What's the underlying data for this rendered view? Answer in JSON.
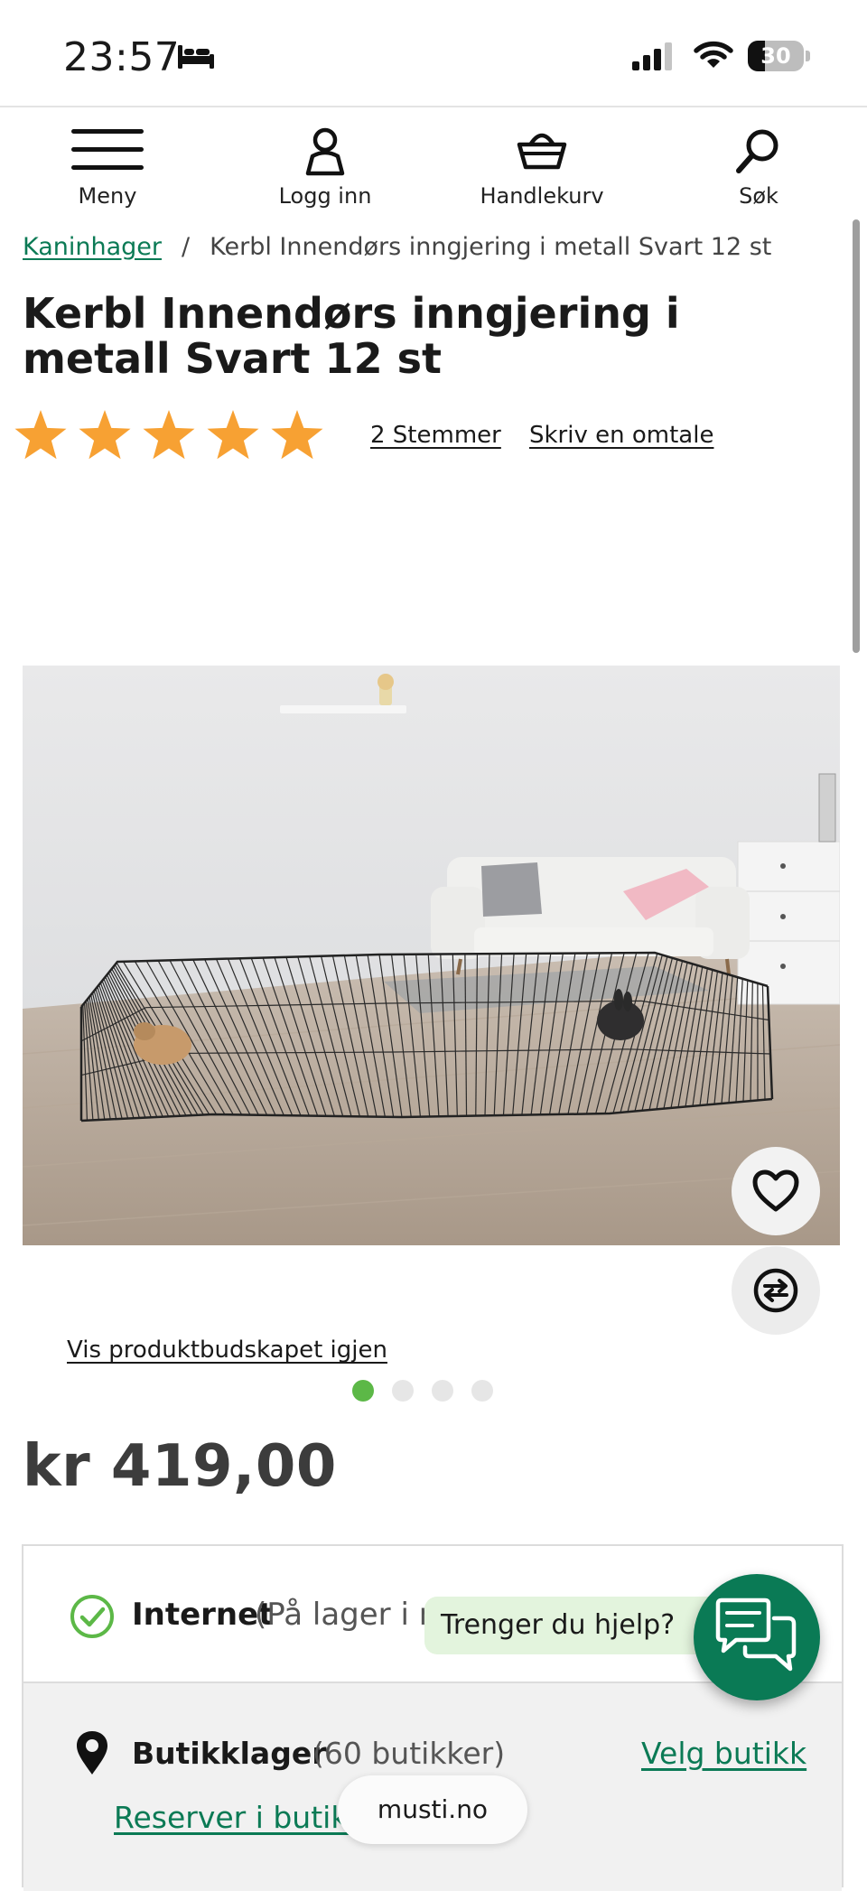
{
  "status_bar": {
    "time": "23:57",
    "battery_level": "30",
    "battery_fraction": 0.3,
    "signal_bars": 3,
    "signal_max": 4
  },
  "nav": {
    "menu_label": "Meny",
    "login_label": "Logg inn",
    "cart_label": "Handlekurv",
    "search_label": "Søk"
  },
  "breadcrumb": {
    "parent": "Kaninhager",
    "separator": "/",
    "current": "Kerbl Innendørs inngjering i metall Svart 12 st"
  },
  "product": {
    "title": "Kerbl Innendørs inngjering i metall Svart 12 st",
    "rating": 5,
    "rating_max": 5,
    "votes_label": "2 Stemmer",
    "review_label": "Skriv en omtale",
    "show_message_label": "Vis produktbudskapet igjen",
    "gallery": {
      "count": 4,
      "active_index": 0
    },
    "price": "kr 419,00"
  },
  "availability": {
    "internet_label": "Internet",
    "internet_status": "(På lager i ne",
    "store_label": "Butikklager",
    "store_count": "(60 butikker)",
    "choose_store_label": "Velg butikk",
    "reserve_label": "Reserver i butikk"
  },
  "help": {
    "bubble_text": "Trenger du hjelp?"
  },
  "browser": {
    "url": "musti.no"
  },
  "colors": {
    "brand_green": "#0b7a55",
    "star": "#f7a133",
    "dot_active": "#5cb847",
    "help_bubble": "#e3f4dd"
  },
  "icons": {
    "status": [
      "bed-icon",
      "signal-icon",
      "wifi-icon",
      "battery-icon"
    ],
    "nav": [
      "menu-icon",
      "user-icon",
      "basket-icon",
      "search-icon"
    ],
    "product": [
      "star-icon",
      "heart-icon",
      "compare-icon",
      "check-circle-icon",
      "location-pin-icon",
      "chat-icon"
    ]
  }
}
